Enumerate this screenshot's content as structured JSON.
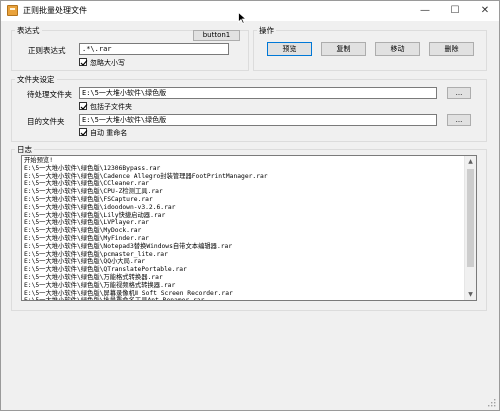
{
  "window": {
    "title": "正则批量处理文件",
    "controls": [
      "—",
      "☐",
      "✕"
    ]
  },
  "regex_group": {
    "title": "表达式",
    "test_button": "button1",
    "regex_label": "正则表达式",
    "regex_value": ".*\\.rar",
    "ignore_case_label": "忽略大小写",
    "ignore_case_checked": true
  },
  "actions_group": {
    "title": "操作",
    "buttons": [
      "预览",
      "复制",
      "移动",
      "删除"
    ]
  },
  "folders_group": {
    "title": "文件夹设定",
    "source_label": "待处理文件夹",
    "source_value": "E:\\5一大堆小软件\\绿色版",
    "browse_label": "...",
    "include_sub_label": "包括子文件夹",
    "include_sub_checked": true,
    "target_label": "目的文件夹",
    "target_value": "E:\\5一大堆小软件\\绿色版",
    "auto_rename_label": "自动 重命名",
    "auto_rename_checked": true
  },
  "log_group": {
    "title": "日志",
    "lines": [
      "开始预览!",
      "E:\\5一大堆小软件\\绿色版\\12306Bypass.rar",
      "E:\\5一大堆小软件\\绿色版\\Cadence Allegro封装管理器FootPrintManager.rar",
      "E:\\5一大堆小软件\\绿色版\\CCleaner.rar",
      "E:\\5一大堆小软件\\绿色版\\CPU-Z检测工具.rar",
      "E:\\5一大堆小软件\\绿色版\\FSCapture.rar",
      "E:\\5一大堆小软件\\绿色版\\idoodown-v3.2.6.rar",
      "E:\\5一大堆小软件\\绿色版\\Lily快捷启动器.rar",
      "E:\\5一大堆小软件\\绿色版\\LVPlayer.rar",
      "E:\\5一大堆小软件\\绿色版\\MyDock.rar",
      "E:\\5一大堆小软件\\绿色版\\MyFinder.rar",
      "E:\\5一大堆小软件\\绿色版\\Notepad3替换Windows自带文本编辑器.rar",
      "E:\\5一大堆小软件\\绿色版\\pcmaster_lite.rar",
      "E:\\5一大堆小软件\\绿色版\\QQ小大局.rar",
      "E:\\5一大堆小软件\\绿色版\\QTranslatePortable.rar",
      "E:\\5一大堆小软件\\绿色版\\万能格式转换器.rar",
      "E:\\5一大堆小软件\\绿色版\\万能视频格式转换器.rar",
      "E:\\5一大堆小软件\\绿色版\\屏幕录像机Ⅱ Soft Screen Recorder.rar",
      "E:\\5一大堆小软件\\绿色版\\批量重命名工具Ant Renamer.rar",
      "E:\\5一大堆小软件\\绿色版\\文件重命名工具ReNamer.rar"
    ]
  },
  "icons": {
    "app": "app-icon",
    "check": "checkmark-icon",
    "scroll_up": "scroll-up-arrow-icon",
    "scroll_down": "scroll-down-arrow-icon",
    "cursor": "mouse-cursor-icon",
    "grip": "resize-grip-icon"
  },
  "colors": {
    "window_bg": "#f0f0f0",
    "titlebar_bg": "#ffffff",
    "focus_border": "#0078d7"
  }
}
